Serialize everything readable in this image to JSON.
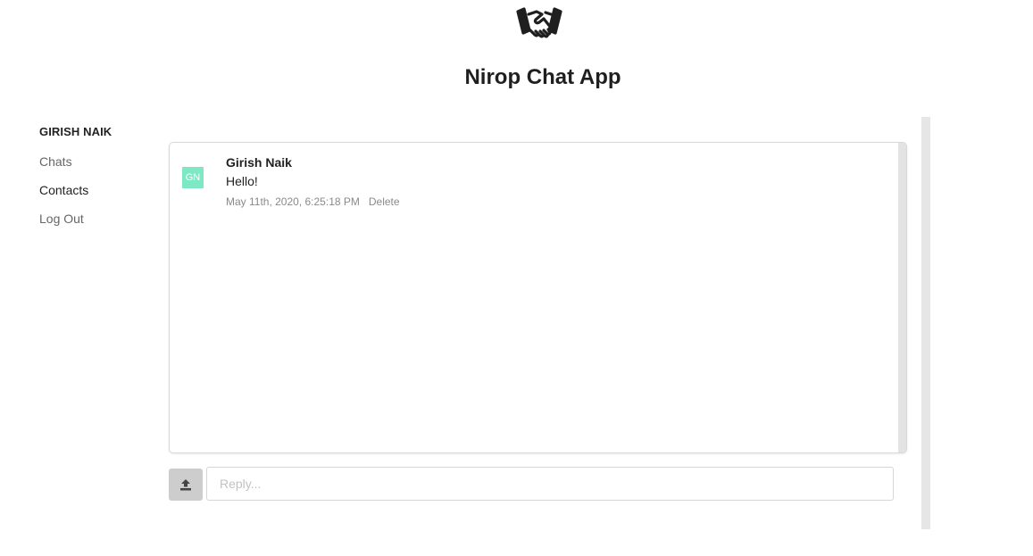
{
  "app": {
    "title": "Nirop Chat App",
    "logo_icon": "handshake-icon"
  },
  "sidebar": {
    "user_name": "GIRISH NAIK",
    "items": [
      {
        "label": "Chats"
      },
      {
        "label": "Contacts"
      },
      {
        "label": "Log Out"
      }
    ]
  },
  "chat": {
    "messages": [
      {
        "avatar_initials": "GN",
        "avatar_color": "#7ee8c4",
        "sender": "Girish Naik",
        "text": "Hello!",
        "timestamp": "May 11th, 2020, 6:25:18 PM",
        "delete_label": "Delete"
      }
    ]
  },
  "composer": {
    "upload_icon": "upload-icon",
    "reply_placeholder": "Reply...",
    "reply_value": ""
  }
}
